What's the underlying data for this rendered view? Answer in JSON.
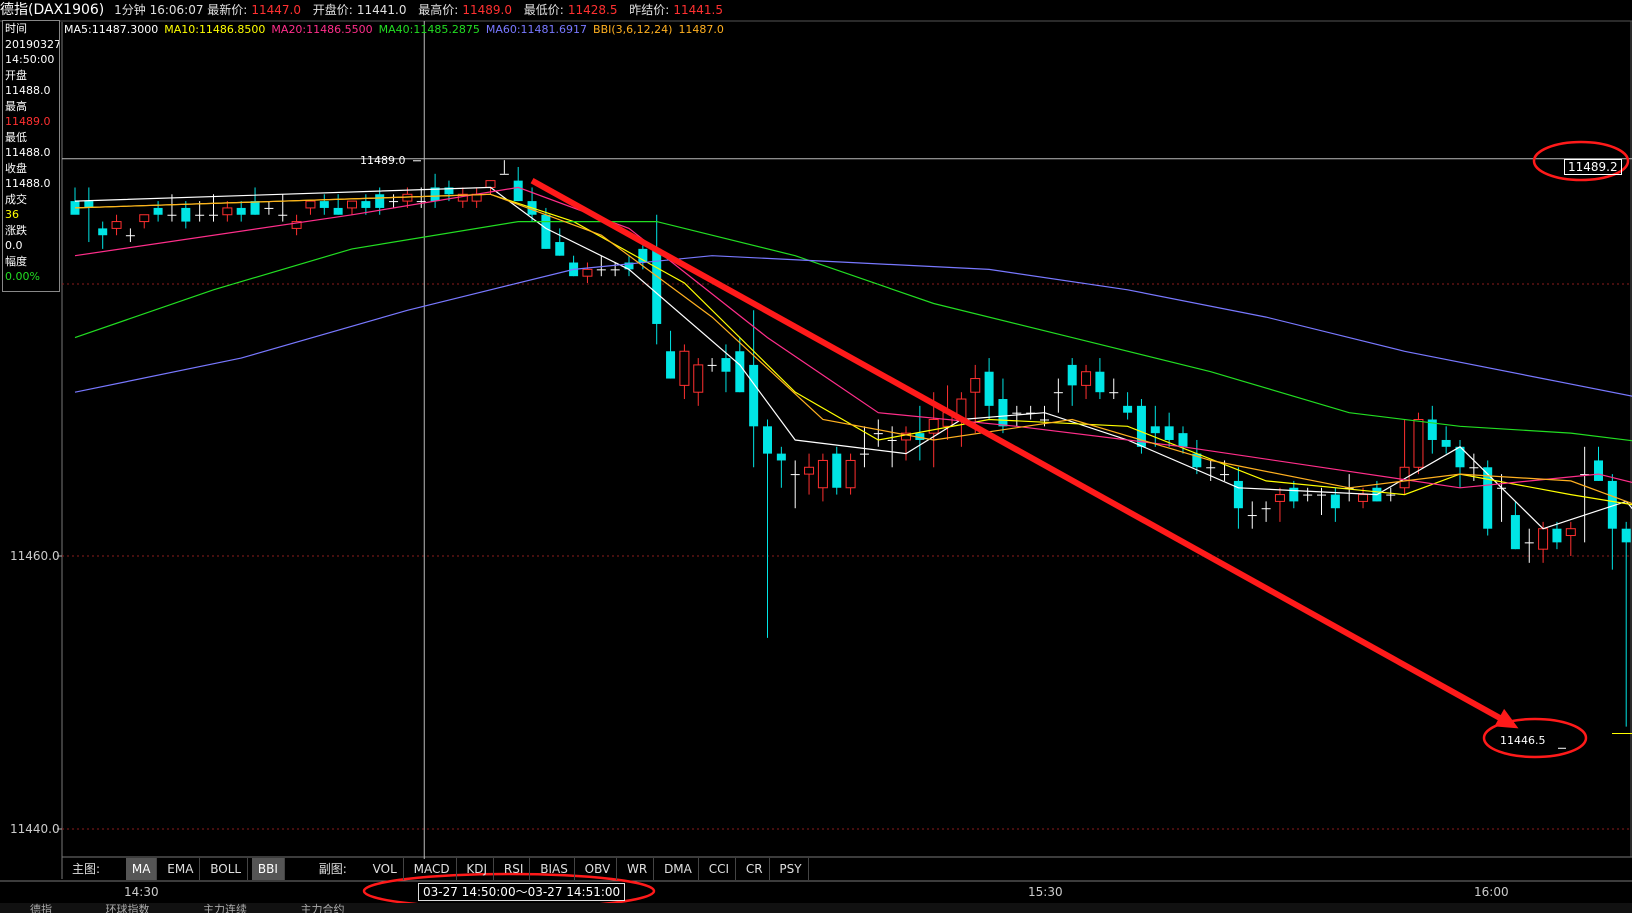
{
  "topbar": {
    "title": "德指(DAX1906)",
    "period": "1分钟",
    "time": "16:06:07",
    "last_label": "最新价:",
    "last_value": "11447.0",
    "open_label": "开盘价:",
    "open_value": "11441.0",
    "high_label": "最高价:",
    "high_value": "11489.0",
    "low_label": "最低价:",
    "low_value": "11428.5",
    "prev_label": "昨结价:",
    "prev_value": "11441.5"
  },
  "indicators": [
    {
      "text": "MA5:11487.3000",
      "color": "#ffffff"
    },
    {
      "text": "MA10:11486.8500",
      "color": "#ffff00"
    },
    {
      "text": "MA20:11486.5500",
      "color": "#ff2e8a"
    },
    {
      "text": "MA40:11485.2875",
      "color": "#22dd22"
    },
    {
      "text": "MA60:11481.6917",
      "color": "#7878ff"
    },
    {
      "text": "BBI(3,6,12,24)",
      "color": "#ffb020"
    },
    {
      "text": "11487.0",
      "color": "#ffb020"
    }
  ],
  "infobox": {
    "time_label": "时间",
    "date": "20190327",
    "time": "14:50:00",
    "open_label": "开盘",
    "open": "11488.0",
    "high_label": "最高",
    "high": "11489.0",
    "low_label": "最低",
    "low": "11488.0",
    "close_label": "收盘",
    "close": "11488.0",
    "volume_label": "成交",
    "volume": "36",
    "change_label": "涨跌",
    "change": "0.0",
    "pct_label": "幅度",
    "pct": "0.00%"
  },
  "y_axis": {
    "label_11460": "11460.0",
    "label_11440": "11440.0"
  },
  "price_tags": {
    "crosshair_price": "11489.0",
    "right_price": "11489.2",
    "last_price": "11446.5"
  },
  "main_tabs": {
    "label": "主图:",
    "items": [
      "MA",
      "EMA",
      "BOLL",
      "BBI"
    ],
    "active": [
      "MA",
      "BBI"
    ]
  },
  "sub_tabs": {
    "label": "副图:",
    "items": [
      "VOL",
      "MACD",
      "KDJ",
      "RSI",
      "BIAS",
      "OBV",
      "WR",
      "DMA",
      "CCI",
      "CR",
      "PSY"
    ]
  },
  "time_axis": {
    "t1": "14:30",
    "t2": "15:30",
    "t3": "16:00",
    "range": "03-27  14:50:00〜03-27 14:51:00"
  },
  "bottom_tabs": [
    "德指",
    "环球指数",
    "主力连续",
    "主力合约"
  ],
  "colors": {
    "up": "#ff3030",
    "down": "#00e5e5",
    "annotation": "#ff1a1a",
    "ma5": "#ffffff",
    "ma10": "#ffff00",
    "ma20": "#ff2e8a",
    "ma40": "#22dd22",
    "ma60": "#7878ff",
    "bbi": "#ffb020"
  },
  "chart_data": {
    "type": "candlestick",
    "y_ticks": [
      11460.0,
      11440.0
    ],
    "ylim": [
      11439,
      11490
    ],
    "candles": [
      {
        "o": 11486.0,
        "h": 11487.0,
        "l": 11485.5,
        "c": 11485.0
      },
      {
        "o": 11486.0,
        "h": 11487.0,
        "l": 11483.0,
        "c": 11485.5
      },
      {
        "o": 11484.0,
        "h": 11484.5,
        "l": 11482.5,
        "c": 11483.5
      },
      {
        "o": 11484.0,
        "h": 11485.0,
        "l": 11483.5,
        "c": 11484.5
      },
      {
        "o": 11483.5,
        "h": 11484.0,
        "l": 11483.0,
        "c": 11483.5
      },
      {
        "o": 11484.5,
        "h": 11485.0,
        "l": 11484.0,
        "c": 11485.0
      },
      {
        "o": 11485.5,
        "h": 11486.0,
        "l": 11484.5,
        "c": 11485.0
      },
      {
        "o": 11485.0,
        "h": 11486.5,
        "l": 11484.5,
        "c": 11485.0
      },
      {
        "o": 11485.5,
        "h": 11486.0,
        "l": 11484.0,
        "c": 11484.5
      },
      {
        "o": 11485.0,
        "h": 11486.0,
        "l": 11484.5,
        "c": 11485.0
      },
      {
        "o": 11485.0,
        "h": 11486.5,
        "l": 11484.5,
        "c": 11485.0
      },
      {
        "o": 11485.0,
        "h": 11486.0,
        "l": 11484.5,
        "c": 11485.5
      },
      {
        "o": 11485.5,
        "h": 11486.0,
        "l": 11484.5,
        "c": 11485.0
      },
      {
        "o": 11486.0,
        "h": 11487.0,
        "l": 11485.0,
        "c": 11485.0
      },
      {
        "o": 11485.5,
        "h": 11486.0,
        "l": 11485.0,
        "c": 11485.5
      },
      {
        "o": 11485.0,
        "h": 11486.5,
        "l": 11484.5,
        "c": 11485.0
      },
      {
        "o": 11484.0,
        "h": 11485.0,
        "l": 11483.5,
        "c": 11484.5
      },
      {
        "o": 11485.5,
        "h": 11486.0,
        "l": 11485.0,
        "c": 11486.0
      },
      {
        "o": 11486.0,
        "h": 11486.5,
        "l": 11485.0,
        "c": 11485.5
      },
      {
        "o": 11485.5,
        "h": 11486.5,
        "l": 11485.0,
        "c": 11485.0
      },
      {
        "o": 11485.5,
        "h": 11486.0,
        "l": 11485.0,
        "c": 11486.0
      },
      {
        "o": 11486.0,
        "h": 11486.5,
        "l": 11485.0,
        "c": 11485.5
      },
      {
        "o": 11486.5,
        "h": 11487.0,
        "l": 11485.0,
        "c": 11485.5
      },
      {
        "o": 11486.0,
        "h": 11486.5,
        "l": 11485.5,
        "c": 11486.0
      },
      {
        "o": 11486.0,
        "h": 11487.0,
        "l": 11485.5,
        "c": 11486.5
      },
      {
        "o": 11486.0,
        "h": 11487.0,
        "l": 11485.5,
        "c": 11486.0
      },
      {
        "o": 11487.0,
        "h": 11488.0,
        "l": 11485.5,
        "c": 11486.0
      },
      {
        "o": 11487.0,
        "h": 11487.5,
        "l": 11486.0,
        "c": 11486.5
      },
      {
        "o": 11486.0,
        "h": 11487.0,
        "l": 11485.5,
        "c": 11486.5
      },
      {
        "o": 11486.0,
        "h": 11487.0,
        "l": 11485.5,
        "c": 11486.5
      },
      {
        "o": 11487.0,
        "h": 11487.5,
        "l": 11486.5,
        "c": 11487.5
      },
      {
        "o": 11488.0,
        "h": 11489.0,
        "l": 11488.0,
        "c": 11488.0
      },
      {
        "o": 11487.5,
        "h": 11488.5,
        "l": 11486.0,
        "c": 11486.0
      },
      {
        "o": 11486.0,
        "h": 11487.0,
        "l": 11484.5,
        "c": 11485.0
      },
      {
        "o": 11485.0,
        "h": 11485.5,
        "l": 11482.5,
        "c": 11482.5
      },
      {
        "o": 11483.0,
        "h": 11484.0,
        "l": 11482.0,
        "c": 11482.0
      },
      {
        "o": 11481.5,
        "h": 11482.0,
        "l": 11480.5,
        "c": 11480.5
      },
      {
        "o": 11480.5,
        "h": 11481.5,
        "l": 11480.0,
        "c": 11481.0
      },
      {
        "o": 11481.0,
        "h": 11482.0,
        "l": 11480.5,
        "c": 11481.0
      },
      {
        "o": 11481.0,
        "h": 11481.5,
        "l": 11480.5,
        "c": 11481.0
      },
      {
        "o": 11481.5,
        "h": 11482.0,
        "l": 11480.5,
        "c": 11481.0
      },
      {
        "o": 11482.5,
        "h": 11483.0,
        "l": 11481.0,
        "c": 11481.5
      },
      {
        "o": 11482.5,
        "h": 11485.0,
        "l": 11475.5,
        "c": 11477.0
      },
      {
        "o": 11475.0,
        "h": 11476.5,
        "l": 11473.0,
        "c": 11473.0
      },
      {
        "o": 11472.5,
        "h": 11475.5,
        "l": 11471.5,
        "c": 11475.0
      },
      {
        "o": 11472.0,
        "h": 11474.5,
        "l": 11471.0,
        "c": 11474.0
      },
      {
        "o": 11474.0,
        "h": 11474.5,
        "l": 11473.5,
        "c": 11474.0
      },
      {
        "o": 11474.5,
        "h": 11475.5,
        "l": 11472.0,
        "c": 11473.5
      },
      {
        "o": 11475.0,
        "h": 11476.0,
        "l": 11472.0,
        "c": 11472.0
      },
      {
        "o": 11474.0,
        "h": 11478.0,
        "l": 11466.5,
        "c": 11469.5
      },
      {
        "o": 11469.5,
        "h": 11470.0,
        "l": 11454.0,
        "c": 11467.5
      },
      {
        "o": 11467.5,
        "h": 11468.0,
        "l": 11465.0,
        "c": 11467.0
      },
      {
        "o": 11466.0,
        "h": 11467.0,
        "l": 11463.5,
        "c": 11466.0
      },
      {
        "o": 11466.0,
        "h": 11467.5,
        "l": 11464.5,
        "c": 11466.5
      },
      {
        "o": 11465.0,
        "h": 11467.5,
        "l": 11464.0,
        "c": 11467.0
      },
      {
        "o": 11467.5,
        "h": 11468.0,
        "l": 11464.5,
        "c": 11465.0
      },
      {
        "o": 11465.0,
        "h": 11467.5,
        "l": 11464.5,
        "c": 11467.0
      },
      {
        "o": 11467.5,
        "h": 11469.5,
        "l": 11466.5,
        "c": 11467.5
      },
      {
        "o": 11469.0,
        "h": 11470.0,
        "l": 11468.0,
        "c": 11469.0
      },
      {
        "o": 11468.5,
        "h": 11469.5,
        "l": 11466.5,
        "c": 11468.5
      },
      {
        "o": 11468.5,
        "h": 11469.5,
        "l": 11467.0,
        "c": 11469.0
      },
      {
        "o": 11469.0,
        "h": 11471.0,
        "l": 11467.0,
        "c": 11468.5
      },
      {
        "o": 11469.0,
        "h": 11472.0,
        "l": 11466.5,
        "c": 11470.0
      },
      {
        "o": 11469.5,
        "h": 11472.5,
        "l": 11468.5,
        "c": 11470.5
      },
      {
        "o": 11470.0,
        "h": 11472.0,
        "l": 11468.0,
        "c": 11471.5
      },
      {
        "o": 11472.0,
        "h": 11474.0,
        "l": 11469.0,
        "c": 11473.0
      },
      {
        "o": 11473.5,
        "h": 11474.5,
        "l": 11470.0,
        "c": 11471.0
      },
      {
        "o": 11471.5,
        "h": 11473.0,
        "l": 11469.0,
        "c": 11469.5
      },
      {
        "o": 11470.5,
        "h": 11471.0,
        "l": 11469.5,
        "c": 11470.5
      },
      {
        "o": 11470.5,
        "h": 11471.0,
        "l": 11470.0,
        "c": 11470.5
      },
      {
        "o": 11470.0,
        "h": 11471.0,
        "l": 11469.5,
        "c": 11470.0
      },
      {
        "o": 11472.0,
        "h": 11473.0,
        "l": 11470.5,
        "c": 11472.0
      },
      {
        "o": 11474.0,
        "h": 11474.5,
        "l": 11471.0,
        "c": 11472.5
      },
      {
        "o": 11472.5,
        "h": 11474.0,
        "l": 11471.5,
        "c": 11473.5
      },
      {
        "o": 11473.5,
        "h": 11474.5,
        "l": 11471.5,
        "c": 11472.0
      },
      {
        "o": 11472.0,
        "h": 11473.0,
        "l": 11471.5,
        "c": 11472.0
      },
      {
        "o": 11471.0,
        "h": 11472.0,
        "l": 11470.0,
        "c": 11470.5
      },
      {
        "o": 11471.0,
        "h": 11471.5,
        "l": 11467.5,
        "c": 11468.0
      },
      {
        "o": 11469.5,
        "h": 11471.0,
        "l": 11468.0,
        "c": 11469.0
      },
      {
        "o": 11469.5,
        "h": 11470.5,
        "l": 11468.0,
        "c": 11468.5
      },
      {
        "o": 11469.0,
        "h": 11469.5,
        "l": 11467.5,
        "c": 11468.0
      },
      {
        "o": 11467.5,
        "h": 11468.5,
        "l": 11466.0,
        "c": 11466.5
      },
      {
        "o": 11466.5,
        "h": 11467.0,
        "l": 11465.5,
        "c": 11466.5
      },
      {
        "o": 11466.0,
        "h": 11467.0,
        "l": 11465.5,
        "c": 11466.0
      },
      {
        "o": 11465.5,
        "h": 11466.5,
        "l": 11462.0,
        "c": 11463.5
      },
      {
        "o": 11463.0,
        "h": 11464.0,
        "l": 11462.0,
        "c": 11463.0
      },
      {
        "o": 11463.5,
        "h": 11464.0,
        "l": 11462.5,
        "c": 11463.5
      },
      {
        "o": 11464.0,
        "h": 11465.0,
        "l": 11462.5,
        "c": 11464.5
      },
      {
        "o": 11465.0,
        "h": 11465.5,
        "l": 11463.5,
        "c": 11464.0
      },
      {
        "o": 11464.5,
        "h": 11465.0,
        "l": 11464.0,
        "c": 11464.5
      },
      {
        "o": 11464.5,
        "h": 11465.0,
        "l": 11463.0,
        "c": 11464.5
      },
      {
        "o": 11464.5,
        "h": 11465.0,
        "l": 11462.5,
        "c": 11463.5
      },
      {
        "o": 11465.0,
        "h": 11466.0,
        "l": 11464.0,
        "c": 11465.0
      },
      {
        "o": 11464.0,
        "h": 11465.0,
        "l": 11463.5,
        "c": 11464.5
      },
      {
        "o": 11465.0,
        "h": 11465.5,
        "l": 11464.0,
        "c": 11464.0
      },
      {
        "o": 11464.5,
        "h": 11465.0,
        "l": 11464.0,
        "c": 11464.5
      },
      {
        "o": 11465.0,
        "h": 11470.0,
        "l": 11464.5,
        "c": 11466.5
      },
      {
        "o": 11466.5,
        "h": 11470.5,
        "l": 11466.0,
        "c": 11470.0
      },
      {
        "o": 11470.0,
        "h": 11471.0,
        "l": 11467.5,
        "c": 11468.5
      },
      {
        "o": 11468.5,
        "h": 11469.5,
        "l": 11467.5,
        "c": 11468.0
      },
      {
        "o": 11468.0,
        "h": 11468.5,
        "l": 11465.0,
        "c": 11466.5
      },
      {
        "o": 11466.5,
        "h": 11467.5,
        "l": 11465.5,
        "c": 11466.5
      },
      {
        "o": 11466.5,
        "h": 11467.0,
        "l": 11461.5,
        "c": 11462.0
      },
      {
        "o": 11465.0,
        "h": 11466.0,
        "l": 11462.5,
        "c": 11465.0
      },
      {
        "o": 11463.0,
        "h": 11464.0,
        "l": 11460.5,
        "c": 11460.5
      },
      {
        "o": 11461.0,
        "h": 11462.0,
        "l": 11459.5,
        "c": 11461.0
      },
      {
        "o": 11460.5,
        "h": 11462.5,
        "l": 11459.5,
        "c": 11462.0
      },
      {
        "o": 11462.0,
        "h": 11462.5,
        "l": 11460.5,
        "c": 11461.0
      },
      {
        "o": 11461.5,
        "h": 11462.5,
        "l": 11460.0,
        "c": 11462.0
      },
      {
        "o": 11466.0,
        "h": 11468.0,
        "l": 11461.0,
        "c": 11466.0
      },
      {
        "o": 11467.0,
        "h": 11468.0,
        "l": 11465.5,
        "c": 11465.5
      },
      {
        "o": 11465.5,
        "h": 11466.0,
        "l": 11459.0,
        "c": 11462.0
      },
      {
        "o": 11462.0,
        "h": 11462.5,
        "l": 11447.5,
        "c": 11461.0
      },
      {
        "o": 11459.0,
        "h": 11461.0,
        "l": 11455.0,
        "c": 11455.5
      },
      {
        "o": 11455.5,
        "h": 11457.0,
        "l": 11453.5,
        "c": 11454.5
      },
      {
        "o": 11455.0,
        "h": 11456.0,
        "l": 11452.5,
        "c": 11453.5
      },
      {
        "o": 11452.5,
        "h": 11453.5,
        "l": 11451.0,
        "c": 11452.5
      },
      {
        "o": 11451.0,
        "h": 11452.0,
        "l": 11443.5,
        "c": 11448.0
      },
      {
        "o": 11448.0,
        "h": 11448.5,
        "l": 11446.5,
        "c": 11447.0
      }
    ],
    "ma_lines": {
      "MA5": [
        [
          0,
          11486.0
        ],
        [
          30,
          11487.0
        ],
        [
          34,
          11484.0
        ],
        [
          40,
          11481.0
        ],
        [
          48,
          11474.0
        ],
        [
          52,
          11468.5
        ],
        [
          60,
          11467.5
        ],
        [
          64,
          11470.0
        ],
        [
          70,
          11470.5
        ],
        [
          76,
          11468.5
        ],
        [
          84,
          11465.0
        ],
        [
          94,
          11464.5
        ],
        [
          100,
          11468.0
        ],
        [
          106,
          11462.0
        ],
        [
          112,
          11464.0
        ],
        [
          117,
          11458.0
        ],
        [
          120,
          11455.0
        ],
        [
          122,
          11452.0
        ]
      ],
      "MA10": [
        [
          0,
          11485.5
        ],
        [
          30,
          11486.5
        ],
        [
          36,
          11484.5
        ],
        [
          44,
          11480.0
        ],
        [
          52,
          11472.0
        ],
        [
          58,
          11468.5
        ],
        [
          66,
          11470.0
        ],
        [
          76,
          11469.5
        ],
        [
          86,
          11465.5
        ],
        [
          96,
          11464.5
        ],
        [
          100,
          11466.0
        ],
        [
          108,
          11464.5
        ],
        [
          114,
          11463.5
        ],
        [
          118,
          11459.5
        ],
        [
          122,
          11454.0
        ]
      ],
      "MA20": [
        [
          0,
          11482.0
        ],
        [
          20,
          11485.0
        ],
        [
          32,
          11487.0
        ],
        [
          40,
          11484.0
        ],
        [
          50,
          11476.0
        ],
        [
          58,
          11470.5
        ],
        [
          68,
          11469.5
        ],
        [
          80,
          11468.0
        ],
        [
          90,
          11466.5
        ],
        [
          100,
          11465.0
        ],
        [
          110,
          11466.0
        ],
        [
          116,
          11464.5
        ],
        [
          122,
          11461.0
        ]
      ],
      "MA40": [
        [
          0,
          11476.0
        ],
        [
          10,
          11479.5
        ],
        [
          20,
          11482.5
        ],
        [
          32,
          11484.5
        ],
        [
          42,
          11484.5
        ],
        [
          52,
          11482.0
        ],
        [
          62,
          11478.5
        ],
        [
          72,
          11476.0
        ],
        [
          82,
          11473.5
        ],
        [
          92,
          11470.5
        ],
        [
          100,
          11469.5
        ],
        [
          108,
          11469.0
        ],
        [
          116,
          11468.0
        ],
        [
          122,
          11466.0
        ]
      ],
      "MA60": [
        [
          0,
          11472.0
        ],
        [
          12,
          11474.5
        ],
        [
          24,
          11478.0
        ],
        [
          36,
          11481.0
        ],
        [
          46,
          11482.0
        ],
        [
          56,
          11481.5
        ],
        [
          66,
          11481.0
        ],
        [
          76,
          11479.5
        ],
        [
          86,
          11477.5
        ],
        [
          96,
          11475.0
        ],
        [
          106,
          11473.0
        ],
        [
          116,
          11471.0
        ],
        [
          122,
          11467.5
        ]
      ],
      "BBI": [
        [
          0,
          11485.5
        ],
        [
          30,
          11486.5
        ],
        [
          38,
          11483.5
        ],
        [
          46,
          11477.5
        ],
        [
          54,
          11470.0
        ],
        [
          62,
          11468.5
        ],
        [
          72,
          11470.0
        ],
        [
          82,
          11467.0
        ],
        [
          92,
          11465.0
        ],
        [
          100,
          11466.0
        ],
        [
          108,
          11465.5
        ],
        [
          116,
          11462.5
        ],
        [
          122,
          11457.0
        ]
      ]
    }
  }
}
